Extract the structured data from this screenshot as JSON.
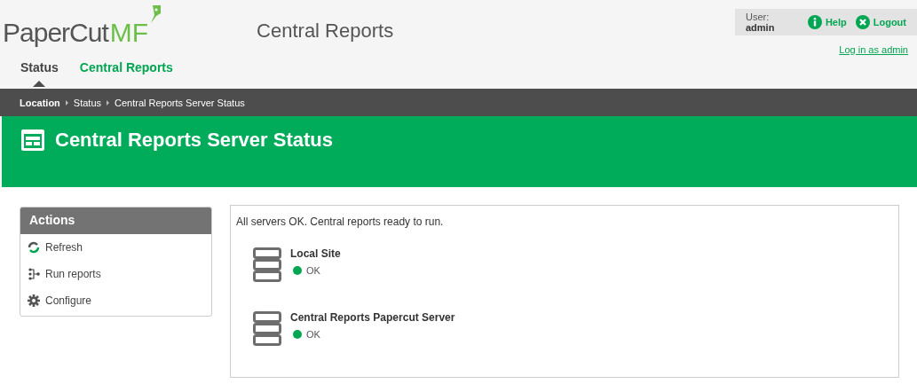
{
  "logo": {
    "brand": "PaperCut",
    "product": "MF"
  },
  "app_title": "Central Reports",
  "user_bar": {
    "label": "User:",
    "user": "admin",
    "links": [
      {
        "kind": "help",
        "label": "Help"
      },
      {
        "kind": "logout",
        "label": "Logout"
      }
    ]
  },
  "login_link": "Log in as admin",
  "tabs": [
    {
      "label": "Status",
      "selected": true
    },
    {
      "label": "Central Reports",
      "selected": false
    }
  ],
  "breadcrumb": [
    "Location",
    "Status",
    "Central Reports Server Status"
  ],
  "page_title": "Central Reports Server Status",
  "actions": {
    "title": "Actions",
    "items": [
      {
        "kind": "refresh",
        "label": "Refresh"
      },
      {
        "kind": "run",
        "label": "Run reports"
      },
      {
        "kind": "configure",
        "label": "Configure"
      }
    ]
  },
  "summary": "All servers OK. Central reports ready to run.",
  "servers": [
    {
      "name": "Local Site",
      "status": "OK",
      "color": "#00a651"
    },
    {
      "name": "Central Reports Papercut Server",
      "status": "OK",
      "color": "#00a651"
    }
  ]
}
